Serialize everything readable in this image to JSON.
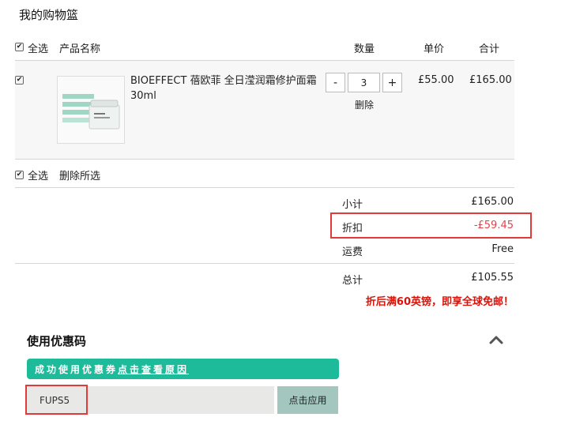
{
  "page": {
    "title": "我的购物篮"
  },
  "header": {
    "select_all": "全选",
    "product_name": "产品名称",
    "quantity": "数量",
    "unit_price": "单价",
    "subtotal": "合计"
  },
  "items": [
    {
      "name": "BIOEFFECT 蓓欧菲 全日滢润霜修护面霜 30ml",
      "quantity": "3",
      "decrement": "-",
      "increment": "+",
      "remove": "删除",
      "unit_price": "£55.00",
      "total": "£165.00"
    }
  ],
  "footer_actions": {
    "select_all": "全选",
    "delete_selected": "删除所选"
  },
  "summary": {
    "subtotal_label": "小计",
    "subtotal_value": "£165.00",
    "discount_label": "折扣",
    "discount_value": "-£59.45",
    "shipping_label": "运费",
    "shipping_value": "Free",
    "total_label": "总计",
    "total_value": "£105.55",
    "promo": "折后满60英镑，即享全球免邮！"
  },
  "coupon": {
    "section_title": "使用优惠码",
    "success_text": "成功使用优惠券",
    "success_link": "点击查看原因",
    "code_value": "FUPS5",
    "apply_label": "点击应用"
  },
  "colors": {
    "discount": "#e5414a",
    "promo": "#d8140a",
    "highlight_border": "#e03a3a",
    "success_bar": "#1dbb9a",
    "apply_button": "#a3c7bf"
  }
}
